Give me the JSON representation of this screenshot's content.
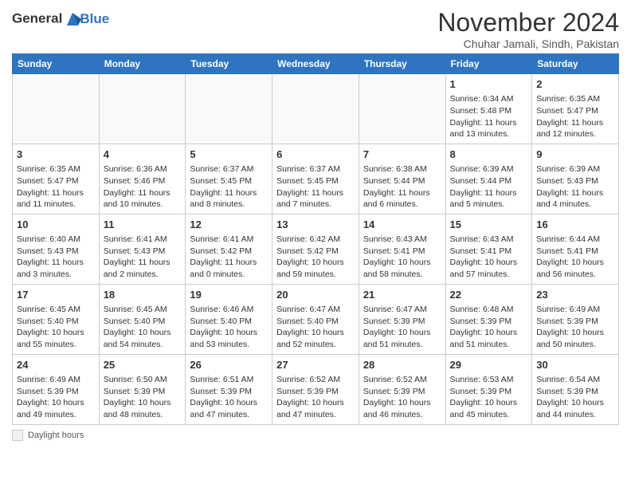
{
  "header": {
    "logo_line1": "General",
    "logo_line2": "Blue",
    "month_title": "November 2024",
    "location": "Chuhar Jamali, Sindh, Pakistan"
  },
  "days_of_week": [
    "Sunday",
    "Monday",
    "Tuesday",
    "Wednesday",
    "Thursday",
    "Friday",
    "Saturday"
  ],
  "weeks": [
    [
      {
        "day": "",
        "data": ""
      },
      {
        "day": "",
        "data": ""
      },
      {
        "day": "",
        "data": ""
      },
      {
        "day": "",
        "data": ""
      },
      {
        "day": "",
        "data": ""
      },
      {
        "day": "1",
        "data": "Sunrise: 6:34 AM\nSunset: 5:48 PM\nDaylight: 11 hours and 13 minutes."
      },
      {
        "day": "2",
        "data": "Sunrise: 6:35 AM\nSunset: 5:47 PM\nDaylight: 11 hours and 12 minutes."
      }
    ],
    [
      {
        "day": "3",
        "data": "Sunrise: 6:35 AM\nSunset: 5:47 PM\nDaylight: 11 hours and 11 minutes."
      },
      {
        "day": "4",
        "data": "Sunrise: 6:36 AM\nSunset: 5:46 PM\nDaylight: 11 hours and 10 minutes."
      },
      {
        "day": "5",
        "data": "Sunrise: 6:37 AM\nSunset: 5:45 PM\nDaylight: 11 hours and 8 minutes."
      },
      {
        "day": "6",
        "data": "Sunrise: 6:37 AM\nSunset: 5:45 PM\nDaylight: 11 hours and 7 minutes."
      },
      {
        "day": "7",
        "data": "Sunrise: 6:38 AM\nSunset: 5:44 PM\nDaylight: 11 hours and 6 minutes."
      },
      {
        "day": "8",
        "data": "Sunrise: 6:39 AM\nSunset: 5:44 PM\nDaylight: 11 hours and 5 minutes."
      },
      {
        "day": "9",
        "data": "Sunrise: 6:39 AM\nSunset: 5:43 PM\nDaylight: 11 hours and 4 minutes."
      }
    ],
    [
      {
        "day": "10",
        "data": "Sunrise: 6:40 AM\nSunset: 5:43 PM\nDaylight: 11 hours and 3 minutes."
      },
      {
        "day": "11",
        "data": "Sunrise: 6:41 AM\nSunset: 5:43 PM\nDaylight: 11 hours and 2 minutes."
      },
      {
        "day": "12",
        "data": "Sunrise: 6:41 AM\nSunset: 5:42 PM\nDaylight: 11 hours and 0 minutes."
      },
      {
        "day": "13",
        "data": "Sunrise: 6:42 AM\nSunset: 5:42 PM\nDaylight: 10 hours and 59 minutes."
      },
      {
        "day": "14",
        "data": "Sunrise: 6:43 AM\nSunset: 5:41 PM\nDaylight: 10 hours and 58 minutes."
      },
      {
        "day": "15",
        "data": "Sunrise: 6:43 AM\nSunset: 5:41 PM\nDaylight: 10 hours and 57 minutes."
      },
      {
        "day": "16",
        "data": "Sunrise: 6:44 AM\nSunset: 5:41 PM\nDaylight: 10 hours and 56 minutes."
      }
    ],
    [
      {
        "day": "17",
        "data": "Sunrise: 6:45 AM\nSunset: 5:40 PM\nDaylight: 10 hours and 55 minutes."
      },
      {
        "day": "18",
        "data": "Sunrise: 6:45 AM\nSunset: 5:40 PM\nDaylight: 10 hours and 54 minutes."
      },
      {
        "day": "19",
        "data": "Sunrise: 6:46 AM\nSunset: 5:40 PM\nDaylight: 10 hours and 53 minutes."
      },
      {
        "day": "20",
        "data": "Sunrise: 6:47 AM\nSunset: 5:40 PM\nDaylight: 10 hours and 52 minutes."
      },
      {
        "day": "21",
        "data": "Sunrise: 6:47 AM\nSunset: 5:39 PM\nDaylight: 10 hours and 51 minutes."
      },
      {
        "day": "22",
        "data": "Sunrise: 6:48 AM\nSunset: 5:39 PM\nDaylight: 10 hours and 51 minutes."
      },
      {
        "day": "23",
        "data": "Sunrise: 6:49 AM\nSunset: 5:39 PM\nDaylight: 10 hours and 50 minutes."
      }
    ],
    [
      {
        "day": "24",
        "data": "Sunrise: 6:49 AM\nSunset: 5:39 PM\nDaylight: 10 hours and 49 minutes."
      },
      {
        "day": "25",
        "data": "Sunrise: 6:50 AM\nSunset: 5:39 PM\nDaylight: 10 hours and 48 minutes."
      },
      {
        "day": "26",
        "data": "Sunrise: 6:51 AM\nSunset: 5:39 PM\nDaylight: 10 hours and 47 minutes."
      },
      {
        "day": "27",
        "data": "Sunrise: 6:52 AM\nSunset: 5:39 PM\nDaylight: 10 hours and 47 minutes."
      },
      {
        "day": "28",
        "data": "Sunrise: 6:52 AM\nSunset: 5:39 PM\nDaylight: 10 hours and 46 minutes."
      },
      {
        "day": "29",
        "data": "Sunrise: 6:53 AM\nSunset: 5:39 PM\nDaylight: 10 hours and 45 minutes."
      },
      {
        "day": "30",
        "data": "Sunrise: 6:54 AM\nSunset: 5:39 PM\nDaylight: 10 hours and 44 minutes."
      }
    ]
  ],
  "legend": {
    "label": "Daylight hours"
  }
}
